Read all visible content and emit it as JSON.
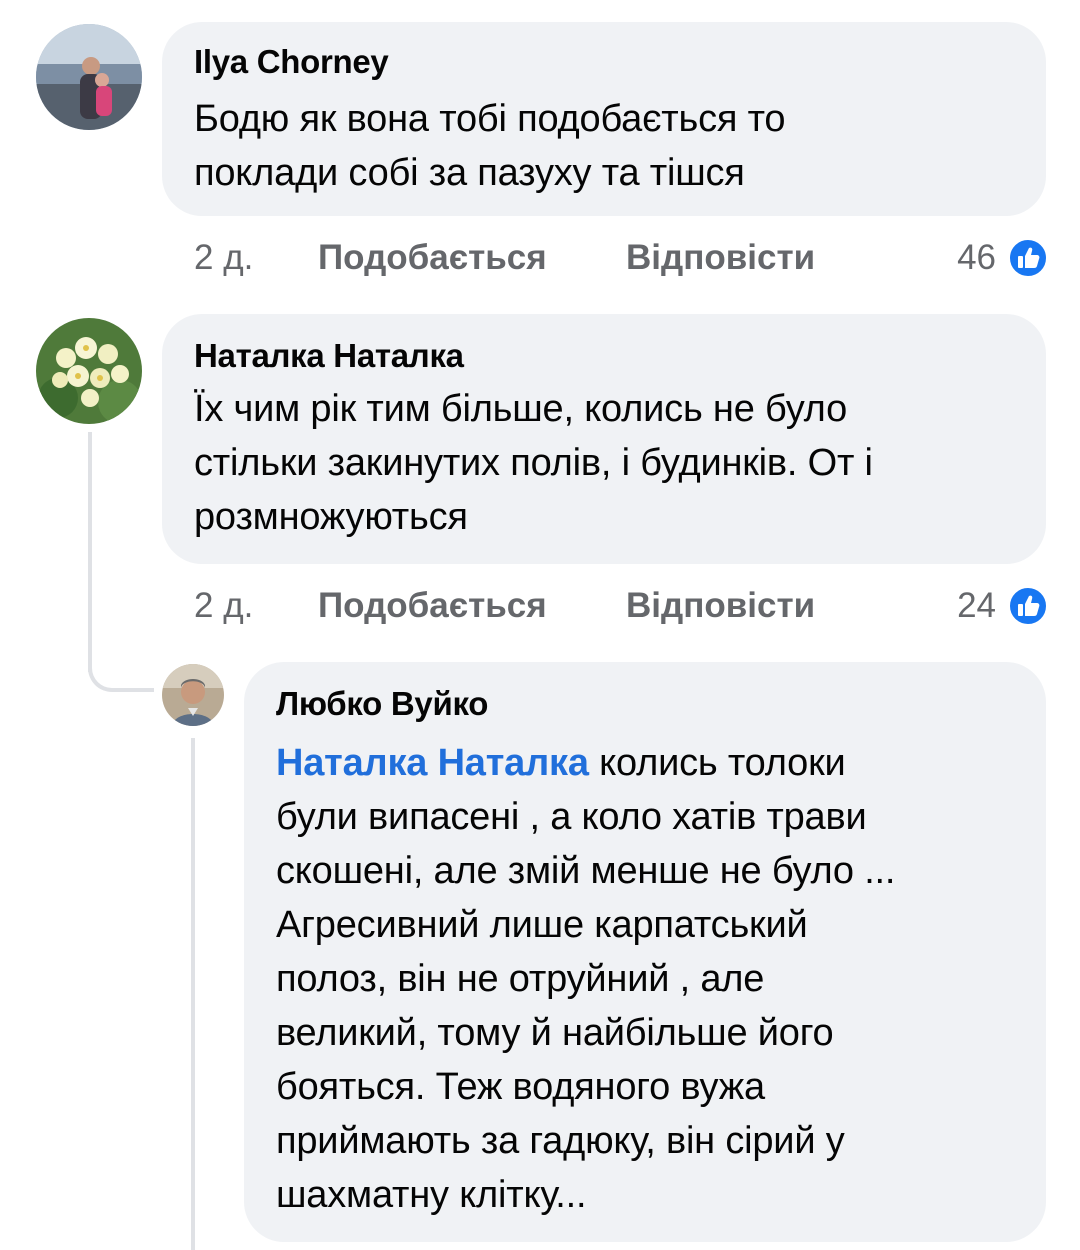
{
  "comments": [
    {
      "author": "Ilya Chorney",
      "text_lines": [
        "Бодю як вона тобі подобається то",
        "поклади собі за пазуху та тішся"
      ],
      "time": "2 д.",
      "like_label": "Подобається",
      "reply_label": "Відповісти",
      "reactions": "46"
    },
    {
      "author": "Наталка Наталка",
      "text_lines": [
        "Їх чим рік тим більше, колись не було",
        "стільки закинутих полів, і будинків. От і",
        "розмножуються"
      ],
      "time": "2 д.",
      "like_label": "Подобається",
      "reply_label": "Відповісти",
      "reactions": "24"
    },
    {
      "author": "Любко Вуйко",
      "mention": "Наталка Наталка",
      "first_line_rest": " колись толоки",
      "text_lines": [
        "були випасені , а коло хатів трави",
        "скошені, але змій менше не було ...",
        "Агресивний лише карпатський",
        "полоз, він не отруйний , але",
        "великий, тому й найбільше його",
        "бояться. Теж водяного вужа",
        "приймають за гадюку, він сірий у",
        "шахматну клітку..."
      ]
    }
  ],
  "colors": {
    "bubble": "#f0f2f5",
    "mention": "#216fdb",
    "meta": "#65676b",
    "like_badge": "#1877f2"
  },
  "icons": {
    "reaction": "like-thumb-icon"
  }
}
